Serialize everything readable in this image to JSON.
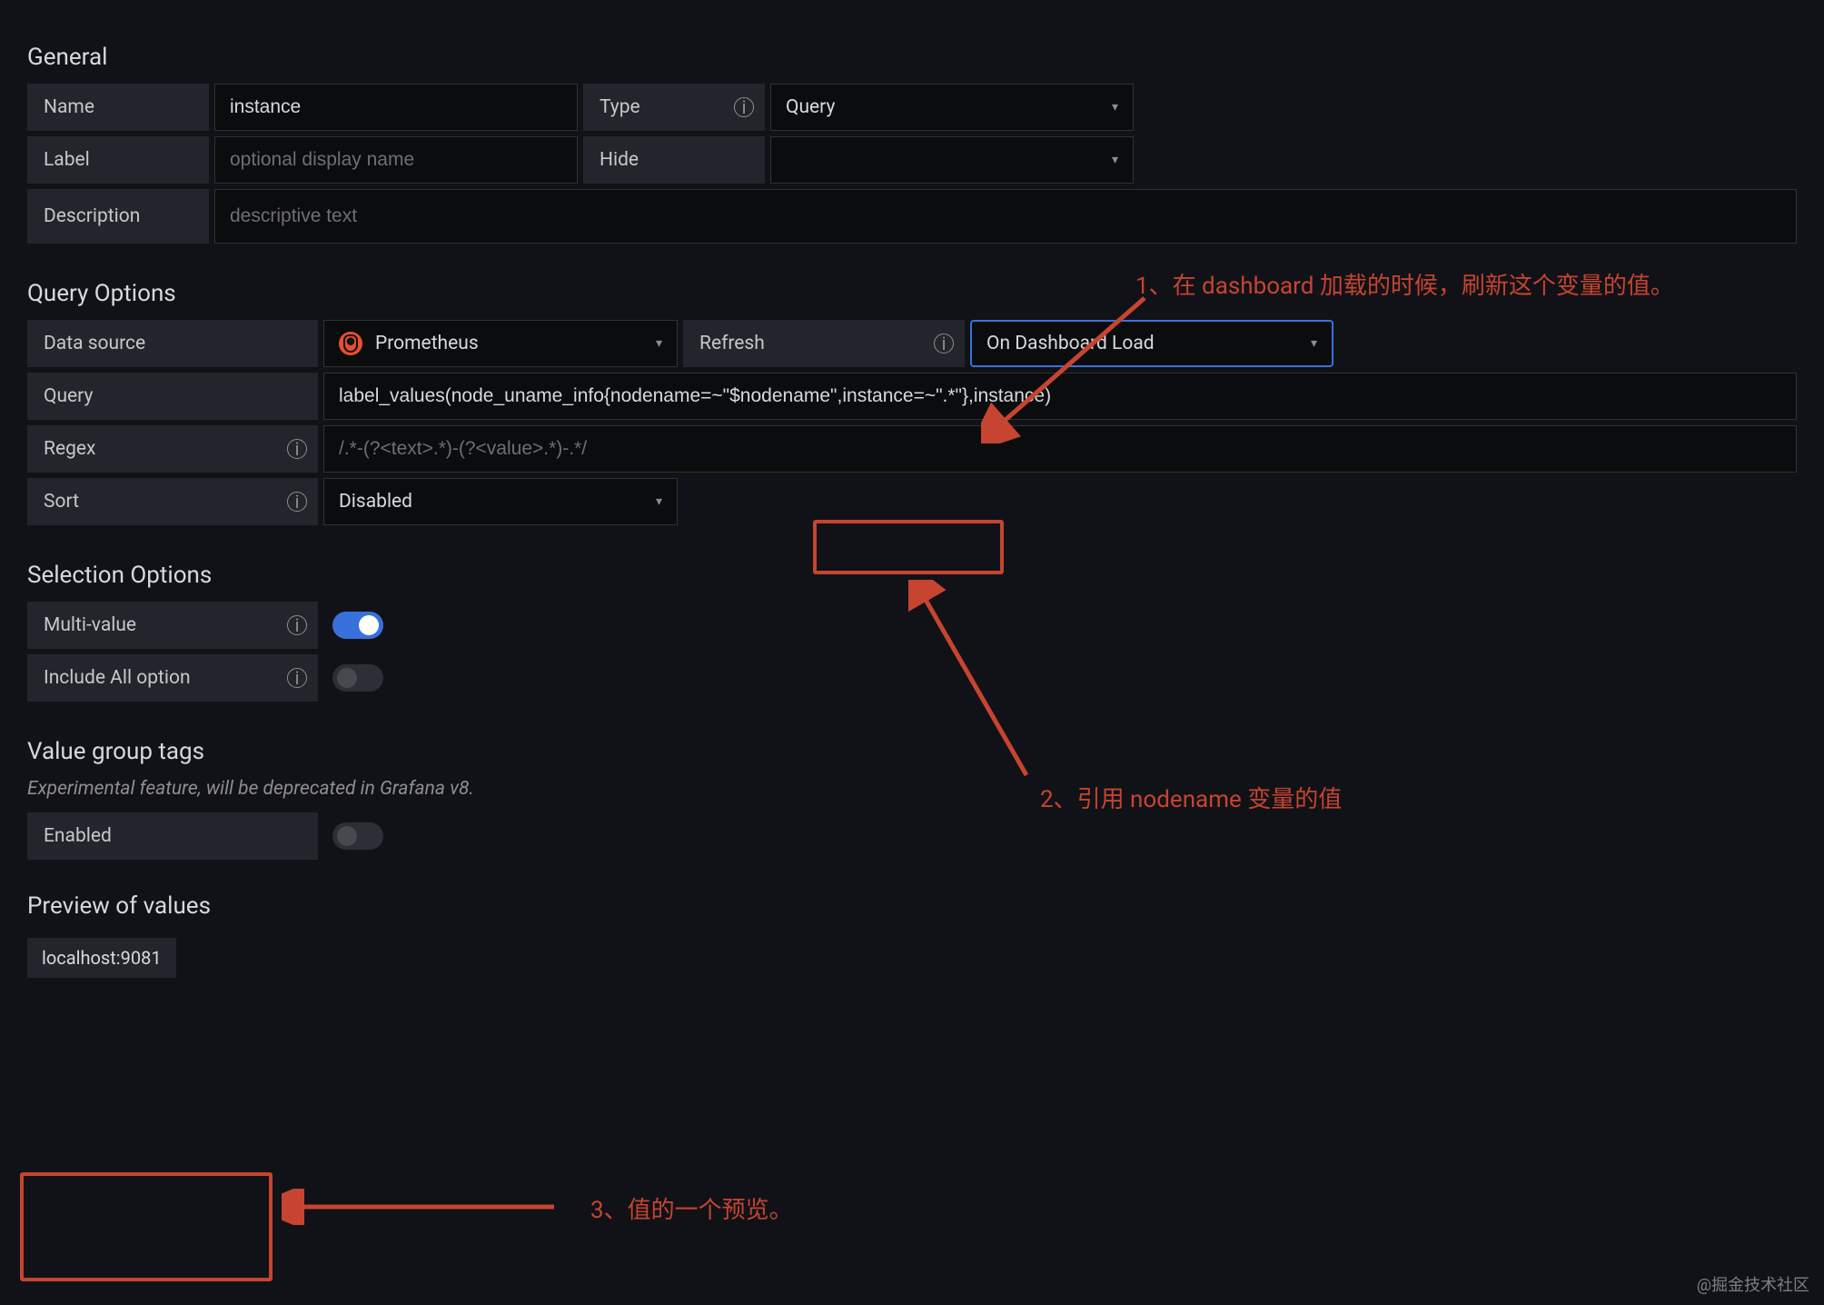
{
  "sections": {
    "general": "General",
    "queryOptions": "Query Options",
    "selectionOptions": "Selection Options",
    "valueGroupTags": "Value group tags",
    "previewOfValues": "Preview of values"
  },
  "general": {
    "name": {
      "label": "Name",
      "value": "instance"
    },
    "type": {
      "label": "Type",
      "value": "Query"
    },
    "labelField": {
      "label": "Label",
      "placeholder": "optional display name"
    },
    "hide": {
      "label": "Hide",
      "value": ""
    },
    "description": {
      "label": "Description",
      "placeholder": "descriptive text"
    }
  },
  "queryOptions": {
    "dataSource": {
      "label": "Data source",
      "value": "Prometheus"
    },
    "refresh": {
      "label": "Refresh",
      "value": "On Dashboard Load"
    },
    "query": {
      "label": "Query",
      "value": "label_values(node_uname_info{nodename=~\"$nodename\",instance=~\".*\"},instance)"
    },
    "regex": {
      "label": "Regex",
      "placeholder": "/.*-(?<text>.*)-(?<value>.*)-.*/"
    },
    "sort": {
      "label": "Sort",
      "value": "Disabled"
    }
  },
  "selectionOptions": {
    "multiValue": {
      "label": "Multi-value",
      "on": true
    },
    "includeAll": {
      "label": "Include All option",
      "on": false
    }
  },
  "valueGroupTags": {
    "subtext": "Experimental feature, will be deprecated in Grafana v8.",
    "enabled": {
      "label": "Enabled",
      "on": false
    }
  },
  "preview": {
    "values": [
      "localhost:9081"
    ]
  },
  "annotations": {
    "a1": "1、在 dashboard 加载的时候，刷新这个变量的值。",
    "a2": "2、引用 nodename 变量的值",
    "a3": "3、值的一个预览。"
  },
  "watermark": "@掘金技术社区",
  "icons": {
    "info": "i",
    "chevronDown": "▾"
  }
}
